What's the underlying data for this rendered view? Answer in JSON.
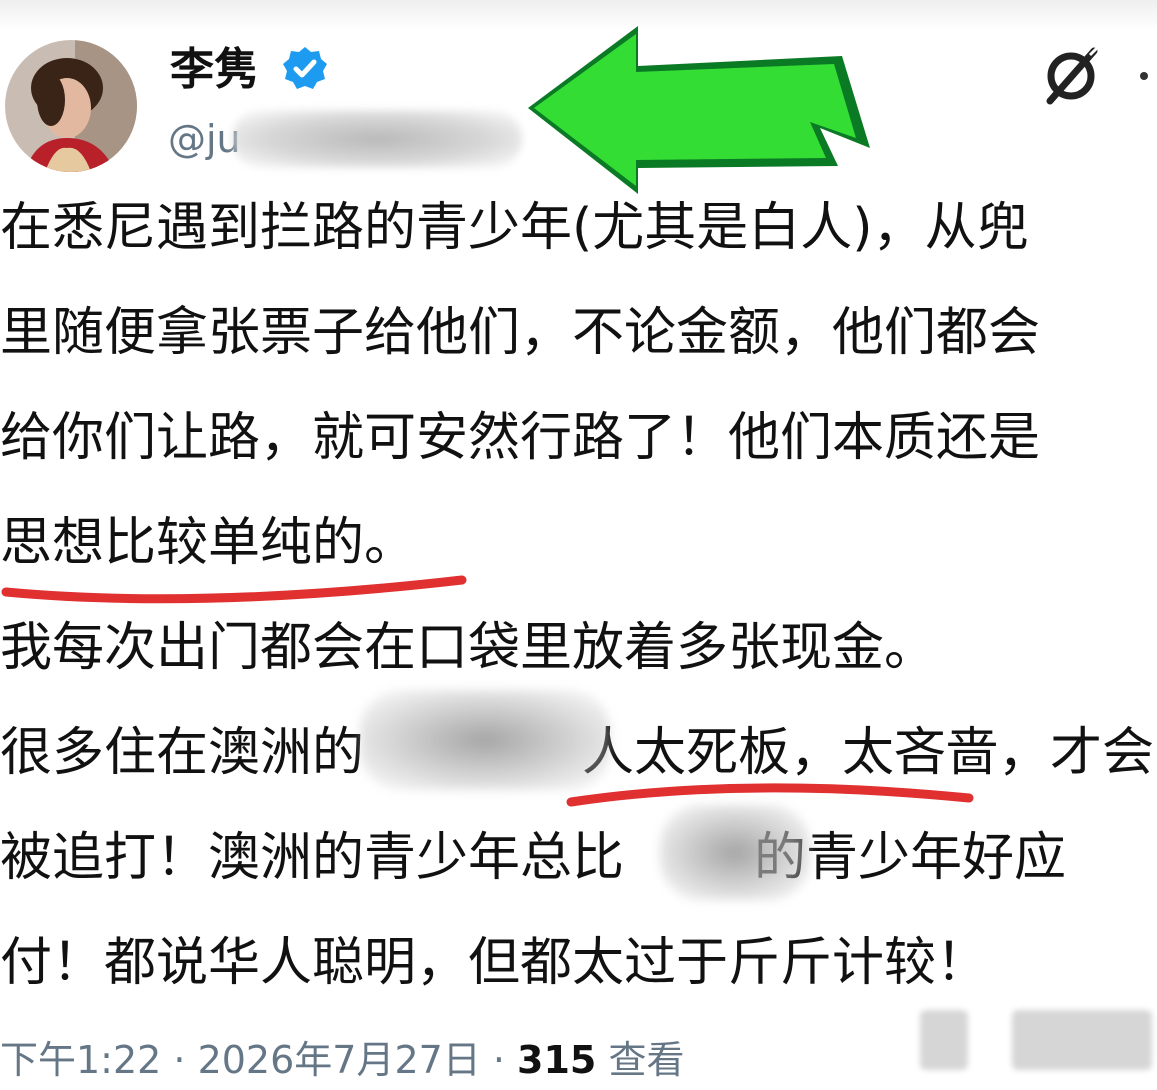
{
  "author": {
    "display_name": "李隽",
    "handle": "@ju",
    "verified": true,
    "avatar_icon": "profile-photo"
  },
  "header_icons": {
    "grok": "grok-icon",
    "more": "more-icon"
  },
  "annotation": {
    "arrow_color": "#33cc33",
    "underline_color": "#e03030"
  },
  "tweet": {
    "lines": [
      "在悉尼遇到拦路的青少年(尤其是白人)，从兜",
      "里随便拿张票子给他们，不论金额，他们都会",
      "给你们让路，就可安然行路了！他们本质还是",
      "思想比较单纯的。",
      "我每次出门都会在口袋里放着多张现金。",
      "很多住在澳洲的",
      "人太死板，太吝啬，才会",
      "被追打！澳洲的青少年总比",
      "的青少年好应",
      "付！都说华人聪明，但都太过于斤斤计较！"
    ]
  },
  "footer": {
    "timestamp": "下午1:22 · 2026年7月27日 · ",
    "views_count": "315",
    "views_label": " 查看"
  }
}
